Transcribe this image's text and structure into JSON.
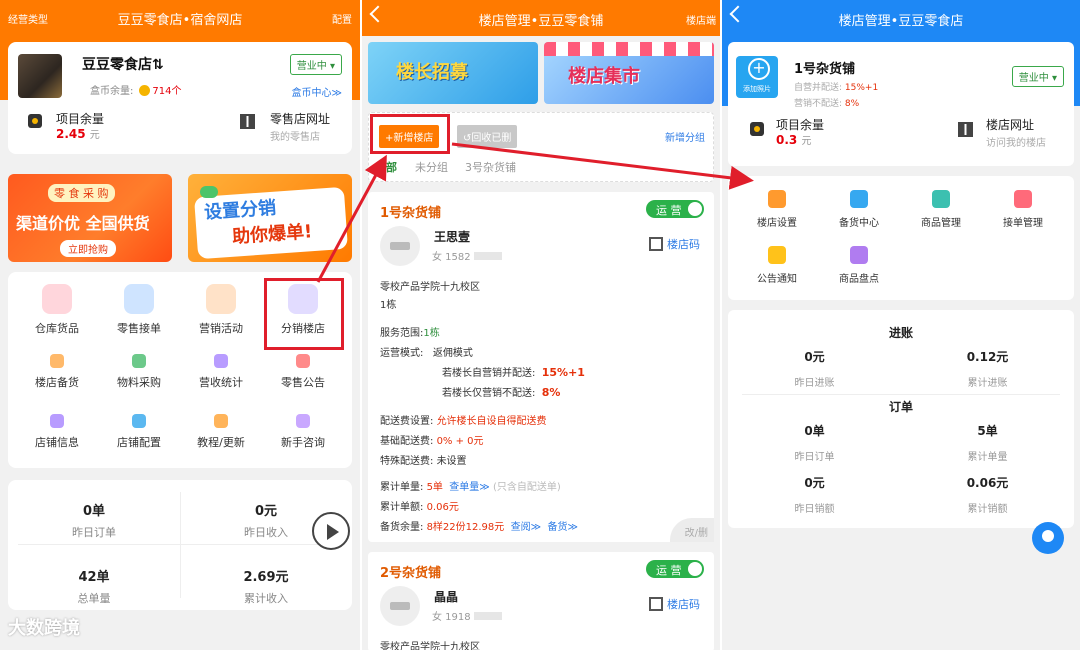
{
  "panel1": {
    "header": {
      "left": "经营类型",
      "title": "豆豆零食店•宿舍网店",
      "right": "配置"
    },
    "shop": {
      "name": "豆豆零食店⇅",
      "coin_label": "盒币余量:",
      "coin_value": "714个",
      "status": "营业中 ▾",
      "center_link": "盒币中心≫",
      "balance_label": "项目余量",
      "balance_value": "2.45",
      "balance_unit": "元",
      "store_url_label": "零售店网址",
      "store_url_sub": "我的零售店"
    },
    "banner1": {
      "top": "零 食 采 购",
      "main": "渠道价优 全国供货",
      "button": "立即抢购"
    },
    "banner2": {
      "line1": "设置分销",
      "line2": "助你爆单!"
    },
    "grid_top": [
      "仓库货品",
      "零售接单",
      "营销活动",
      "分销楼店"
    ],
    "grid_mid": [
      "楼店备货",
      "物料采购",
      "营收统计",
      "零售公告"
    ],
    "grid_bot": [
      "店铺信息",
      "店铺配置",
      "教程/更新",
      "新手咨询"
    ],
    "stats": [
      {
        "value": "0单",
        "label": "昨日订单"
      },
      {
        "value": "0元",
        "label": "昨日收入"
      },
      {
        "value": "42单",
        "label": "总单量"
      },
      {
        "value": "2.69元",
        "label": "累计收入"
      }
    ],
    "watermark": "大数跨境"
  },
  "panel2": {
    "header": {
      "title": "楼店管理•豆豆零食铺",
      "right": "楼店端"
    },
    "banner1": {
      "a": "楼长",
      "b": "招募"
    },
    "banner2": {
      "text": "楼店集市"
    },
    "toolbar": {
      "new": "+新增楼店",
      "recycle": "↺回收已删",
      "add_group": "新增分组"
    },
    "tabs": [
      "全部",
      "未分组",
      "3号杂货铺"
    ],
    "store1": {
      "name": "1号杂货铺",
      "status": "运 营",
      "manager": "王思壹",
      "gender_phone": "女  1582",
      "qr": "楼店码",
      "school": "零校产品学院十九校区",
      "building": "1栋",
      "scope_label": "服务范围:",
      "scope_value": "1栋",
      "mode_label": "运营模式:",
      "mode_value": "返佣模式",
      "rule1_label": "若楼长自营销并配送:",
      "rule1_value": "15%+1",
      "rule2_label": "若楼长仅营销不配送:",
      "rule2_value": "8%",
      "fee_setting_label": "配送费设置:",
      "fee_setting_value": "允许楼长自设自得配送费",
      "base_fee_label": "基础配送费:",
      "base_fee_value": "0% + 0元",
      "special_fee_label": "特殊配送费:",
      "special_fee_value": "未设置",
      "orders_label": "累计单量:",
      "orders_value": "5单",
      "orders_link": "查单量≫",
      "orders_note": "(只含自配送单)",
      "amount_label": "累计单额:",
      "amount_value": "0.06元",
      "stock_label": "备货余量:",
      "stock_value": "8样22份12.98元",
      "stock_link1": "查阅≫",
      "stock_link2": "备货≫",
      "corner": "改/删"
    },
    "store2": {
      "name": "2号杂货铺",
      "status": "运 营",
      "manager": "晶晶",
      "gender_phone": "女  1918",
      "qr": "楼店码",
      "school": "零校产品学院十九校区"
    }
  },
  "panel3": {
    "header": {
      "title": "楼店管理•豆豆零食店"
    },
    "store": {
      "add_photo": "添加照片",
      "name": "1号杂货铺",
      "line1_label": "自营并配送: ",
      "line1_value": "15%+1",
      "line2_label": "营销不配送: ",
      "line2_value": "8%",
      "status": "营业中 ▾",
      "balance_label": "项目余量",
      "balance_value": "0.3",
      "balance_unit": "元",
      "url_label": "楼店网址",
      "url_sub": "访问我的楼店"
    },
    "menu": [
      "楼店设置",
      "备货中心",
      "商品管理",
      "接单管理",
      "公告通知",
      "商品盘点"
    ],
    "income": {
      "title": "进账",
      "items": [
        {
          "value": "0元",
          "label": "昨日进账"
        },
        {
          "value": "0.12元",
          "label": "累计进账"
        }
      ]
    },
    "orders": {
      "title": "订单",
      "items": [
        {
          "value": "0单",
          "label": "昨日订单"
        },
        {
          "value": "5单",
          "label": "累计单量"
        },
        {
          "value": "0元",
          "label": "昨日销额"
        },
        {
          "value": "0.06元",
          "label": "累计销额"
        }
      ]
    }
  },
  "colors": {
    "orange": "#ff7a00",
    "blue": "#1e88f5",
    "green": "#2bb14a",
    "red": "#e01e2b"
  }
}
